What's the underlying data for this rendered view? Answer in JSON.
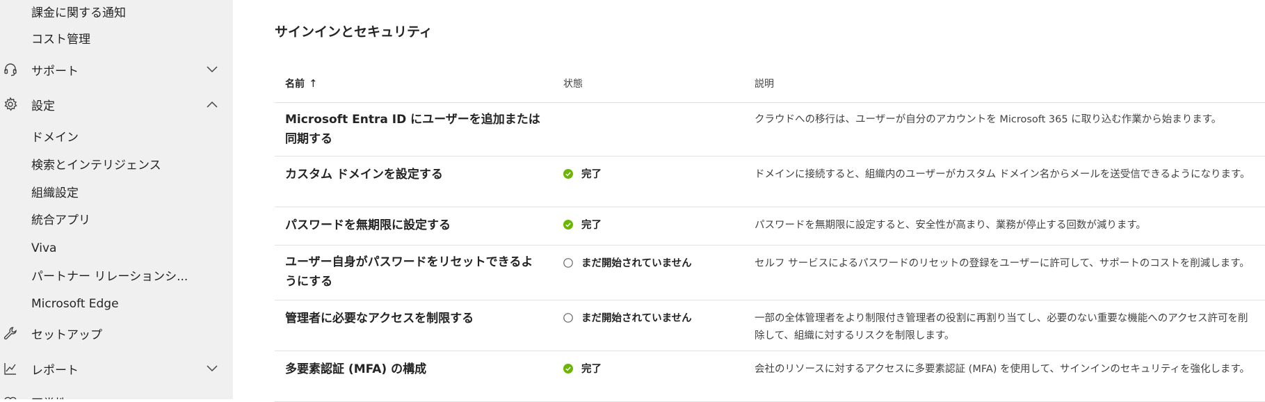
{
  "sidebar": {
    "items": [
      {
        "label": "課金に関する通知"
      },
      {
        "label": "コスト管理"
      },
      {
        "label": "サポート"
      },
      {
        "label": "設定"
      },
      {
        "label": "ドメイン"
      },
      {
        "label": "検索とインテリジェンス"
      },
      {
        "label": "組織設定"
      },
      {
        "label": "統合アプリ"
      },
      {
        "label": "Viva"
      },
      {
        "label": "パートナー リレーションシ..."
      },
      {
        "label": "Microsoft Edge"
      },
      {
        "label": "セットアップ"
      },
      {
        "label": "レポート"
      },
      {
        "label": "正常性"
      }
    ],
    "icons": {
      "support": "headset-icon",
      "settings": "gear-icon",
      "setup": "wrench-icon",
      "reports": "line-chart-icon"
    }
  },
  "main": {
    "title": "サインインとセキュリティ",
    "table": {
      "headers": {
        "name": "名前",
        "sort_indicator": "↑",
        "status": "状態",
        "description": "説明"
      },
      "rows": [
        {
          "name": "Microsoft Entra ID にユーザーを追加または同期する",
          "status": "",
          "status_kind": "none",
          "description": "クラウドへの移行は、ユーザーが自分のアカウントを Microsoft 365 に取り込む作業から始まります。"
        },
        {
          "name": "カスタム ドメインを設定する",
          "status": "完了",
          "status_kind": "complete",
          "description": "ドメインに接続すると、組織内のユーザーがカスタム ドメイン名からメールを送受信できるようになります。"
        },
        {
          "name": "パスワードを無期限に設定する",
          "status": "完了",
          "status_kind": "complete",
          "description": "パスワードを無期限に設定すると、安全性が高まり、業務が停止する回数が減ります。"
        },
        {
          "name": "ユーザー自身がパスワードをリセットできるようにする",
          "status": "まだ開始されていません",
          "status_kind": "not-started",
          "description": "セルフ サービスによるパスワードのリセットの登録をユーザーに許可して、サポートのコストを削減します。"
        },
        {
          "name": "管理者に必要なアクセスを制限する",
          "status": "まだ開始されていません",
          "status_kind": "not-started",
          "description": "一部の全体管理者をより制限付き管理者の役割に再割り当てし、必要のない重要な機能へのアクセス許可を削除して、組織に対するリスクを制限します。"
        },
        {
          "name": "多要素認証 (MFA) の構成",
          "status": "完了",
          "status_kind": "complete",
          "description": "会社のリソースに対するアクセスに多要素認証 (MFA) を使用して、サインインのセキュリティを強化します。"
        }
      ]
    }
  },
  "colors": {
    "sidebar_bg": "#f0f0f0",
    "complete_green": "#6bb700",
    "divider": "#e1e1e1"
  }
}
